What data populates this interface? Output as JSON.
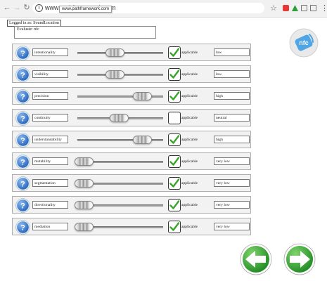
{
  "browser": {
    "url": "www.pathframework.com",
    "url_tooltip": "www.pathframework.com"
  },
  "header": {
    "login_text": "Logged in as: SoundLocation",
    "evaluate_text": "Evaluate: nfc"
  },
  "rows": [
    {
      "label": "intentionality",
      "slider": 0.44,
      "applicable": true,
      "applicable_label": "applicable",
      "value": "low"
    },
    {
      "label": "visibility",
      "slider": 0.44,
      "applicable": true,
      "applicable_label": "applicable",
      "value": "low"
    },
    {
      "label": "precision",
      "slider": 0.83,
      "applicable": true,
      "applicable_label": "applicable",
      "value": "high"
    },
    {
      "label": "continuity",
      "slider": 0.5,
      "applicable": false,
      "applicable_label": "applicable",
      "value": "neutral"
    },
    {
      "label": "understandability",
      "slider": 0.83,
      "applicable": true,
      "applicable_label": "applicable",
      "value": "high"
    },
    {
      "label": "mutability",
      "slider": 0.0,
      "applicable": true,
      "applicable_label": "applicable",
      "value": "very low"
    },
    {
      "label": "segmentation",
      "slider": 0.0,
      "applicable": true,
      "applicable_label": "applicable",
      "value": "very low"
    },
    {
      "label": "directionality",
      "slider": 0.0,
      "applicable": true,
      "applicable_label": "applicable",
      "value": "very low"
    },
    {
      "label": "mediation",
      "slider": 0.0,
      "applicable": true,
      "applicable_label": "applicable",
      "value": "very low"
    }
  ],
  "logo": {
    "text": "nfc"
  },
  "icons": {
    "help": "help-question-icon",
    "back": "back-arrow-icon",
    "forward": "forward-arrow-icon"
  },
  "colors": {
    "help_blue": "#1f5fb8",
    "check_green": "#3aa52b",
    "arrow_green": "#2ea12c",
    "nfc_blue": "#4fa5e6"
  }
}
